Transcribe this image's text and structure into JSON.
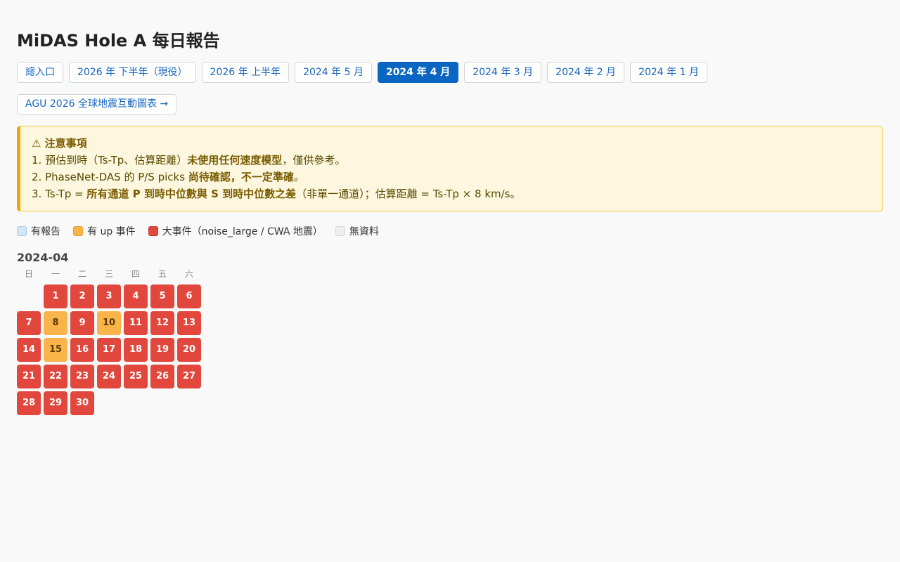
{
  "page_title": "MiDAS Hole A 每日報告",
  "tabs": [
    {
      "label": "總入口",
      "active": false
    },
    {
      "label": "2026 年 下半年（現役）",
      "active": false
    },
    {
      "label": "2026 年 上半年",
      "active": false
    },
    {
      "label": "2024 年 5 月",
      "active": false
    },
    {
      "label": "2024 年 4 月",
      "active": true
    },
    {
      "label": "2024 年 3 月",
      "active": false
    },
    {
      "label": "2024 年 2 月",
      "active": false
    },
    {
      "label": "2024 年 1 月",
      "active": false
    }
  ],
  "agu_link": "AGU 2026 全球地震互動圖表 →",
  "notice": {
    "title": "⚠ 注意事項",
    "line1": {
      "prefix": "1. 預估到時（Ts-Tp、估算距離）",
      "bold": "未使用任何速度模型",
      "suffix": "，僅供參考。"
    },
    "line2": {
      "prefix": "2. PhaseNet-DAS 的 P/S picks ",
      "bold": "尚待確認，不一定準確",
      "suffix": "。"
    },
    "line3": {
      "prefix": "3. Ts-Tp = ",
      "bold": "所有通道 P 到時中位數與 S 到時中位數之差",
      "suffix": "（非單一通道）；估算距離 = Ts-Tp × 8 km/s。"
    }
  },
  "legend": {
    "report": "有報告",
    "up": "有 up 事件",
    "big": "大事件（noise_large / CWA 地震）",
    "none": "無資料"
  },
  "colors": {
    "report": "#d3e6f7",
    "up": "#fbb44a",
    "big": "#e1473c",
    "none": "#eeeeee",
    "active_tab": "#0a66c2"
  },
  "calendar": {
    "month_label": "2024-04",
    "weekdays": [
      "日",
      "一",
      "二",
      "三",
      "四",
      "五",
      "六"
    ],
    "first_weekday_offset": 1,
    "days": [
      {
        "day": "1",
        "status": "big"
      },
      {
        "day": "2",
        "status": "big"
      },
      {
        "day": "3",
        "status": "big"
      },
      {
        "day": "4",
        "status": "big"
      },
      {
        "day": "5",
        "status": "big"
      },
      {
        "day": "6",
        "status": "big"
      },
      {
        "day": "7",
        "status": "big"
      },
      {
        "day": "8",
        "status": "up"
      },
      {
        "day": "9",
        "status": "big"
      },
      {
        "day": "10",
        "status": "up"
      },
      {
        "day": "11",
        "status": "big"
      },
      {
        "day": "12",
        "status": "big"
      },
      {
        "day": "13",
        "status": "big"
      },
      {
        "day": "14",
        "status": "big"
      },
      {
        "day": "15",
        "status": "up"
      },
      {
        "day": "16",
        "status": "big"
      },
      {
        "day": "17",
        "status": "big"
      },
      {
        "day": "18",
        "status": "big"
      },
      {
        "day": "19",
        "status": "big"
      },
      {
        "day": "20",
        "status": "big"
      },
      {
        "day": "21",
        "status": "big"
      },
      {
        "day": "22",
        "status": "big"
      },
      {
        "day": "23",
        "status": "big"
      },
      {
        "day": "24",
        "status": "big"
      },
      {
        "day": "25",
        "status": "big"
      },
      {
        "day": "26",
        "status": "big"
      },
      {
        "day": "27",
        "status": "big"
      },
      {
        "day": "28",
        "status": "big"
      },
      {
        "day": "29",
        "status": "big"
      },
      {
        "day": "30",
        "status": "big"
      }
    ]
  }
}
